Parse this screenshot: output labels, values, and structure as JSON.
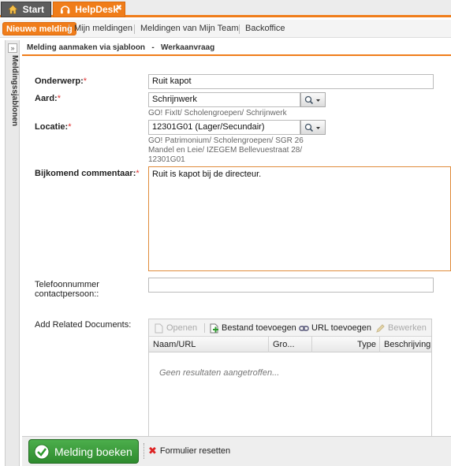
{
  "tabs": [
    {
      "label": "Start",
      "icon": "home-icon"
    },
    {
      "label": "HelpDesk",
      "icon": "headset-icon",
      "close": "✖"
    }
  ],
  "subnav": {
    "items": [
      "Nieuwe melding",
      "Mijn meldingen",
      "Meldingen van Mijn Team",
      "Backoffice"
    ],
    "active_index": 0
  },
  "sidepanel": {
    "title": "Meldingssjablonen",
    "expand_glyph": "»"
  },
  "panel": {
    "title": "Melding aanmaken via sjabloon   -   Werkaanvraag"
  },
  "form": {
    "onderwerp": {
      "label": "Onderwerp:",
      "required": "*",
      "value": "Ruit kapot"
    },
    "aard": {
      "label": "Aard:",
      "required": "*",
      "value": "Schrijnwerk",
      "helper": "GO! FixIt/ Scholengroepen/ Schrijnwerk"
    },
    "locatie": {
      "label": "Locatie:",
      "required": "*",
      "value": "12301G01 (Lager/Secundair)",
      "helper_lines": [
        "GO! Patrimonium/ Scholengroepen/ SGR 26",
        "Mandel en Leie/ IZEGEM Bellevuestraat 28/",
        "12301G01"
      ]
    },
    "commentaar": {
      "label": "Bijkomend commentaar:",
      "required": "*",
      "value": "Ruit is kapot bij de directeur."
    },
    "telefoon": {
      "label_lines": [
        "Telefoonnummer",
        "contactpersoon::"
      ],
      "value": ""
    },
    "documents": {
      "label": "Add Related Documents:"
    }
  },
  "grid": {
    "toolbar": [
      {
        "label": "Openen",
        "icon": "document-icon",
        "enabled": false
      },
      {
        "label": "Bestand toevoegen",
        "icon": "file-add-icon",
        "enabled": true
      },
      {
        "label": "URL toevoegen",
        "icon": "link-icon",
        "enabled": true
      },
      {
        "label": "Bewerken",
        "icon": "pencil-icon",
        "enabled": false
      }
    ],
    "columns": [
      "Naam/URL",
      "Gro...",
      "Type",
      "Beschrijving"
    ],
    "empty_text": "Geen resultaten aangetroffen..."
  },
  "footer": {
    "submit_label": "Melding boeken",
    "reset_label": "Formulier resetten"
  },
  "colors": {
    "accent": "#f07d1a",
    "submit": "#3a9a3a",
    "required": "#e03030"
  }
}
